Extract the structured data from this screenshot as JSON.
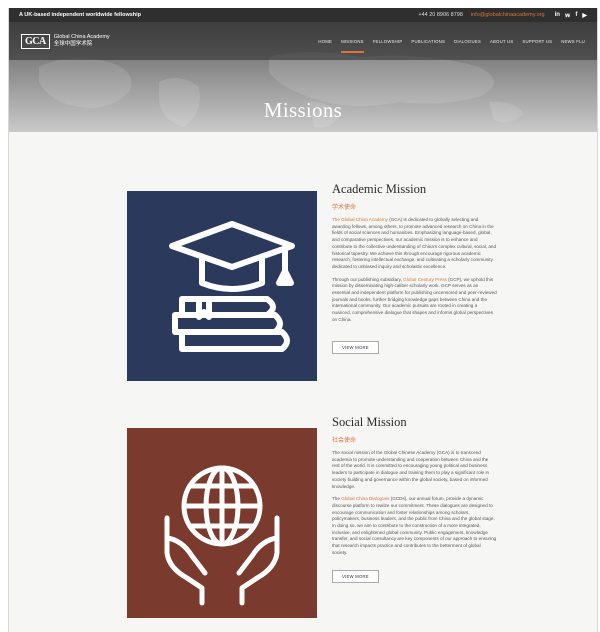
{
  "topbar": {
    "tagline": "A UK-based independent worldwide fellowship",
    "phone": "+44 20 8906 8798",
    "email": "info@globalchinaacademy.org",
    "socials": [
      "in",
      "𝕨",
      "f",
      "▶"
    ]
  },
  "logo": {
    "mark": "GCA",
    "name_en": "Global China Academy",
    "name_zh": "全球中国学术院"
  },
  "nav": [
    "HOME",
    "MISSIONS",
    "FELLOWSHIP",
    "PUBLICATIONS",
    "DIALOGUES",
    "ABOUT US",
    "SUPPORT US",
    "NEWS FLU"
  ],
  "nav_active": "MISSIONS",
  "hero_title": "Missions",
  "academic": {
    "title": "Academic Mission",
    "cn": "学术使命",
    "p1_link": "The Global China Academy",
    "p1": " (GCA) is dedicated to globally selecting and awarding fellows, among others, to promote advanced research on China in the fields of social sciences and humanities. Emphasizing language-based, global, and comparative perspectives, our academic mission is to enhance and contribute to the collective understanding of China's complex cultural, social, and historical tapestry. We achieve this through encourage rigorous academic research, fostering intellectual exchange, and cultivating a scholarly community dedicated to unbiased inquiry and scholastic excellence.",
    "p2_pre": "Through our publishing subsidiary, ",
    "p2_link": "Global Century Press",
    "p2": " (GCP), we uphold this mission by disseminating high-caliber scholarly work. GCP serves as an essential and independent platform for publishing uncensored and peer-reviewed journals and books, further bridging knowledge gaps between China and the international community. Our academic pursuits are rooted in creating a nuanced, comprehensive dialogue that shapes and informs global perspectives on China.",
    "button": "VIEW MORE",
    "color": "#2b3a5c"
  },
  "social": {
    "title": "Social Mission",
    "cn": "社会使命",
    "p1": "The social mission of the Global Chinese Academy (GCA) is to transcend academia to promote understanding and cooperation between China and the rest of the world. It is committed to encouraging young political and business leaders to participate in dialogue and training them to play a significant role in society building and governance within the global society, based on informed knowledge.",
    "p2_pre": "The ",
    "p2_link": "Global China Dialogues",
    "p2": " (GCDs), our annual forum, provide a dynamic discourse platform to realize our commitment. These dialogues are designed to encourage communication and foster relationships among scholars, policymakers, business leaders, and the public from China and the global stage. In doing so, we aim to contribute to the construction of a more integrated, inclusive, and enlightened global community. Public engagement, knowledge transfer, and social consultancy are key components of our approach to ensuring that research impacts practice and contributes to the betterment of global society.",
    "button": "VIEW MORE",
    "color": "#7a3b2e"
  },
  "accent": "#d9743e"
}
